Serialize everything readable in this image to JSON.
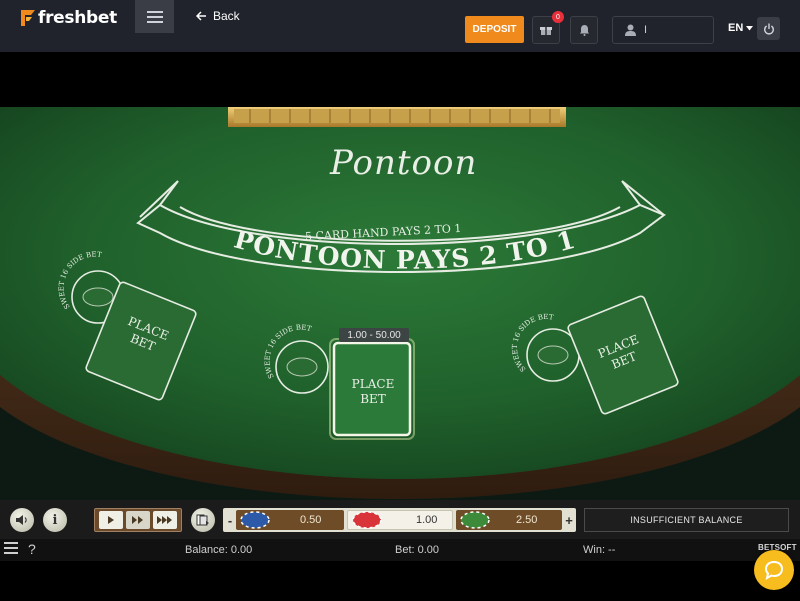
{
  "app": {
    "logo_text": "freshbet",
    "back_label": "Back",
    "deposit_label": "DEPOSIT",
    "gift_badge": "0",
    "username": "I",
    "language": "EN"
  },
  "table": {
    "title": "Pontoon",
    "five_card_text": "5 CARD HAND PAYS 2 TO 1",
    "banner_text": "PONTOON PAYS 2 TO 1",
    "side_bet_label": "SWEET 16 SIDE BET",
    "place_bet_label_1": "PLACE",
    "place_bet_label_2": "BET",
    "bet_limits": "1.00 - 50.00"
  },
  "controls": {
    "sound_icon": "speaker-icon",
    "info_label": "i",
    "speed_icons": [
      "play-icon",
      "fast-forward-icon",
      "fastest-forward-icon"
    ],
    "chips": [
      {
        "value": "0.50",
        "color": "#2c5aa8"
      },
      {
        "value": "1.00",
        "color": "#d8343a"
      },
      {
        "value": "2.50",
        "color": "#3d8a3a"
      }
    ],
    "minus_label": "-",
    "plus_label": "+",
    "status_message": "INSUFFICIENT BALANCE"
  },
  "status": {
    "balance": "Balance: 0.00",
    "bet": "Bet: 0.00",
    "win": "Win: --",
    "provider": "BETSOFT",
    "help": "?"
  },
  "colors": {
    "accent": "#f08a1c",
    "felt": "#1f5e2a",
    "chat": "#f7bd1e"
  }
}
